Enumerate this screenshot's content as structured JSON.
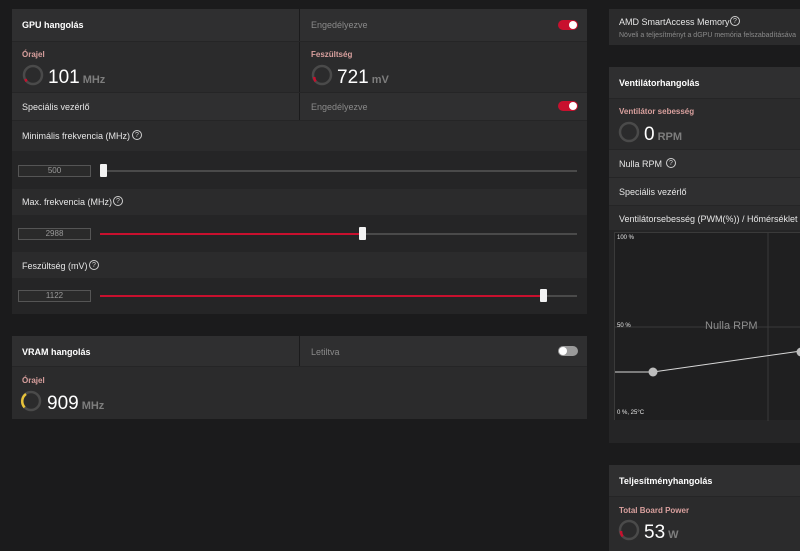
{
  "colors": {
    "accent": "#c8102e",
    "gauge_yellow": "#e8c33a",
    "toggle_off": "#9a9a9a"
  },
  "gpu": {
    "title": "GPU hangolás",
    "toggle_text": "Engedélyezve",
    "clock_label": "Órajel",
    "clock_value": "101",
    "clock_unit": "MHz",
    "voltage_label": "Feszültség",
    "voltage_value": "721",
    "voltage_unit": "mV",
    "adv_label": "Speciális vezérlő",
    "adv_toggle_text": "Engedélyezve",
    "min_freq_label": "Minimális frekvencia (MHz)",
    "min_freq_value": "500",
    "min_freq_fraction": 0.0,
    "max_freq_label": "Max. frekvencia (MHz)",
    "max_freq_value": "2988",
    "max_freq_fraction": 0.55,
    "volt_label": "Feszültség (mV)",
    "volt_value": "1122",
    "volt_fraction": 0.94
  },
  "vram": {
    "title": "VRAM hangolás",
    "toggle_text": "Letiltva",
    "clock_label": "Órajel",
    "clock_value": "909",
    "clock_unit": "MHz"
  },
  "sam": {
    "title": "AMD SmartAccess Memory",
    "desc": "Növeli a teljesítményt a dGPU memória felszabadításáva"
  },
  "fan": {
    "title": "Ventilátorhangolás",
    "speed_label": "Ventilátor sebesség",
    "speed_value": "0",
    "speed_unit": "RPM",
    "zero_rpm_label": "Nulla RPM",
    "adv_label": "Speciális vezérlő",
    "curve_label": "Ventilátorsebesség (PWM(%)) / Hőmérséklet (Ce",
    "chart": {
      "y_top": "100 %",
      "y_mid": "50 %",
      "y_bottom": "0 %, 25°C",
      "overlay": "Nulla RPM"
    }
  },
  "perf": {
    "title": "Teljesítményhangolás",
    "tbp_label": "Total Board Power",
    "tbp_value": "53",
    "tbp_unit": "W"
  }
}
